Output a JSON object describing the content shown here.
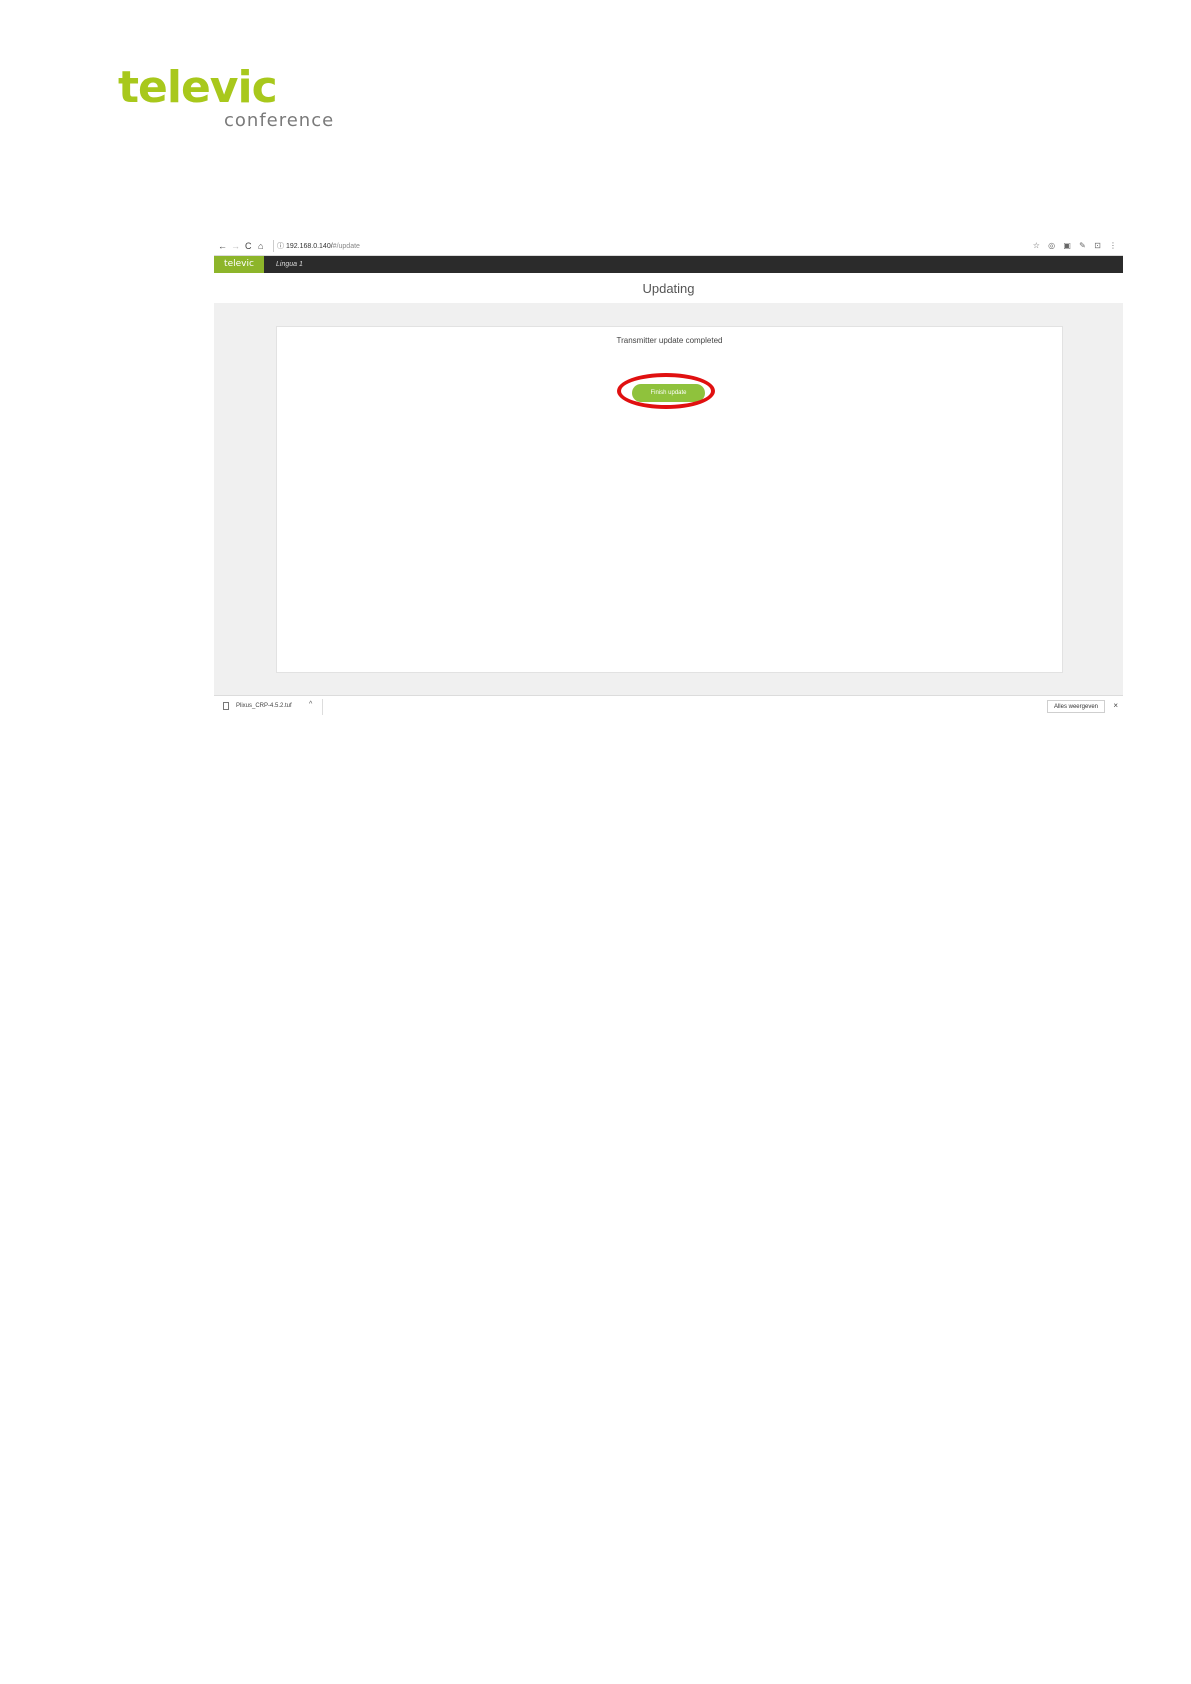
{
  "document": {
    "logo_brand": "televic",
    "logo_sub": "conference"
  },
  "browser": {
    "back_icon": "←",
    "forward_icon": "→",
    "reload_icon": "C",
    "home_icon": "⌂",
    "info_icon": "ⓘ",
    "url_host": "192.168.0.140/",
    "url_path": "#/update",
    "star_icon": "☆",
    "ext_icons": [
      "◎",
      "▣",
      "✎",
      "⊡",
      "⋮"
    ]
  },
  "app": {
    "logo": "televic",
    "language": "Lingua 1",
    "page_title": "Updating",
    "message": "Transmitter update completed",
    "finish_button": "Finish update"
  },
  "downloads": {
    "file_name": "Plixus_CRP-4.5.2.tuf",
    "chevron": "^",
    "show_all": "Alles weergeven",
    "close": "×"
  },
  "colors": {
    "brand_green": "#a8c81c",
    "button_green": "#8fc23c",
    "highlight_red": "#e01010",
    "header_dark": "#2b2b2b"
  }
}
